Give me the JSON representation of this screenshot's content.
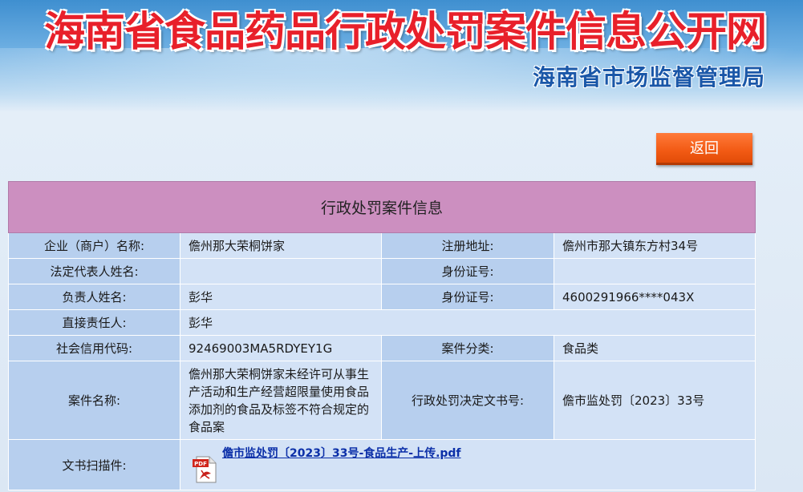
{
  "header": {
    "site_title": "海南省食品药品行政处罚案件信息公开网",
    "bureau": "海南省市场监督管理局"
  },
  "back_button": {
    "label": "返回"
  },
  "table": {
    "title": "行政处罚案件信息",
    "rows": {
      "company": {
        "label": "企业（商户）名称:",
        "value": "儋州那大荣桐饼家"
      },
      "address": {
        "label": "注册地址:",
        "value": "儋州市那大镇东方村34号"
      },
      "legal_rep": {
        "label": "法定代表人姓名:",
        "value": ""
      },
      "legal_id": {
        "label": "身份证号:",
        "value": ""
      },
      "responsible": {
        "label": "负责人姓名:",
        "value": "彭华"
      },
      "responsible_id": {
        "label": "身份证号:",
        "value": "4600291966****043X"
      },
      "direct": {
        "label": "直接责任人:",
        "value": "彭华"
      },
      "credit": {
        "label": "社会信用代码:",
        "value": "92469003MA5RDYEY1G"
      },
      "category": {
        "label": "案件分类:",
        "value": "食品类"
      },
      "case_name": {
        "label": "案件名称:",
        "value": "儋州那大荣桐饼家未经许可从事生产活动和生产经营超限量使用食品添加剂的食品及标签不符合规定的食品案"
      },
      "decision_no": {
        "label": "行政处罚决定文书号:",
        "value": "儋市监处罚〔2023〕33号"
      },
      "scan": {
        "label": "文书扫描件:",
        "file": "儋市监处罚〔2023〕33号-食品生产-上传.pdf"
      }
    }
  },
  "colors": {
    "title_red": "#e8202a",
    "bureau_blue": "#1a57a8",
    "button_orange": "#f25a14",
    "table_head": "#cc8fc0",
    "label_bg": "#b7cfee",
    "value_bg": "#d3e2f6",
    "link": "#0b2fa8"
  },
  "icons": {
    "file": "pdf-icon"
  }
}
